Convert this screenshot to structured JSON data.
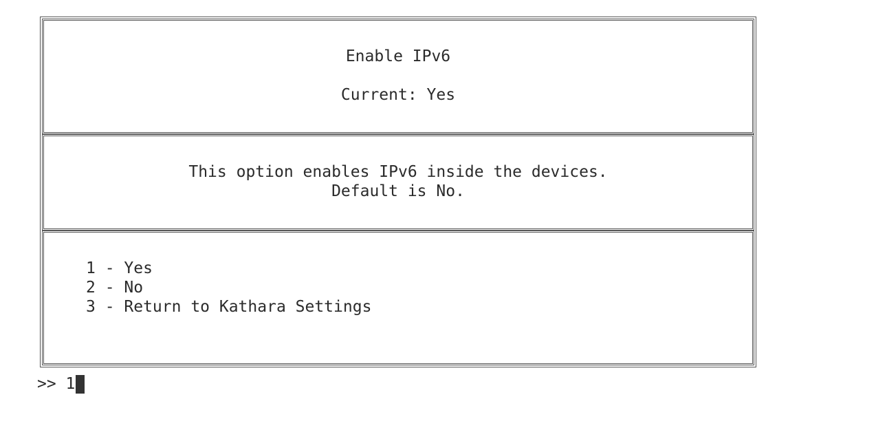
{
  "header": {
    "title": "Enable IPv6",
    "current": "Current: Yes"
  },
  "description": {
    "line1": "This option enables IPv6 inside the devices.",
    "line2": "Default is No."
  },
  "menu": {
    "items": [
      {
        "label": "1 - Yes"
      },
      {
        "label": "2 - No"
      },
      {
        "label": "3 - Return to Kathara Settings"
      }
    ]
  },
  "prompt": {
    "symbol": ">> ",
    "input": "1"
  }
}
